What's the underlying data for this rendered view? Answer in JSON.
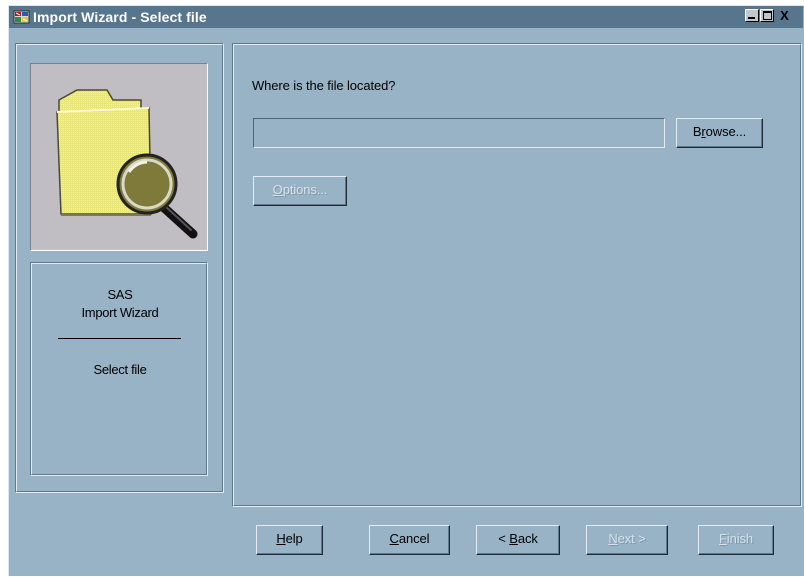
{
  "window": {
    "title": "Import Wizard - Select file",
    "controls": {
      "close_label": "X"
    }
  },
  "sidebar": {
    "image": "folder-magnifier-icon",
    "title": "SAS\nImport Wizard",
    "step": "Select file"
  },
  "main": {
    "prompt": "Where is the file located?",
    "file_path": {
      "value": "",
      "placeholder": ""
    },
    "browse": {
      "before": "B",
      "mnemonic": "r",
      "after": "owse..."
    },
    "options": {
      "mnemonic": "O",
      "after": "ptions...",
      "enabled": false
    }
  },
  "footer": {
    "help": {
      "mnemonic": "H",
      "after": "elp"
    },
    "cancel": {
      "mnemonic": "C",
      "after": "ancel"
    },
    "back": {
      "before": "< ",
      "mnemonic": "B",
      "after": "ack"
    },
    "next": {
      "mnemonic": "N",
      "after": "ext >",
      "enabled": false
    },
    "finish": {
      "mnemonic": "F",
      "after": "inish",
      "enabled": false
    }
  },
  "colors": {
    "window_bg": "#98b3c6",
    "titlebar_bg": "#58758e",
    "picture_bg": "#c0bec2",
    "folder_yellow": "#e8e57a"
  }
}
